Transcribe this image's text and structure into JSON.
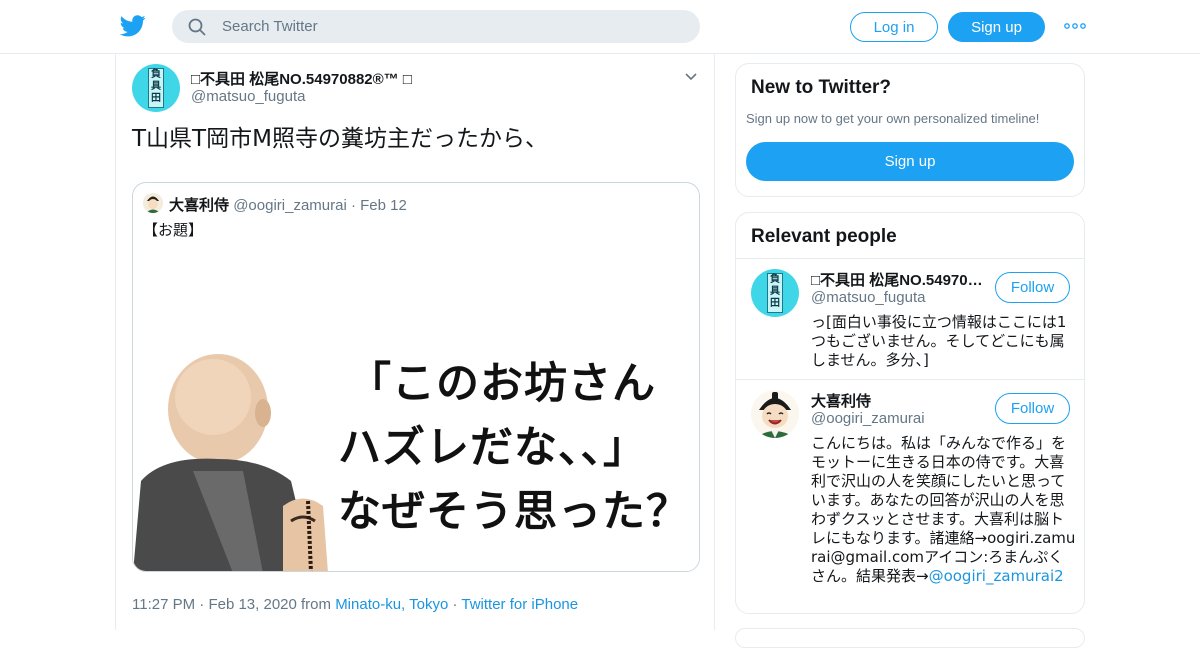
{
  "header": {
    "logo_icon": "twitter-bird-icon",
    "search_placeholder": "Search Twitter",
    "login_label": "Log in",
    "signup_label": "Sign up",
    "more_icon": "more-dots-icon",
    "brand_color": "#1da1f2"
  },
  "tweet": {
    "author_name": "□不具田 松尾NO.54970882®™ □",
    "author_handle": "@matsuo_fuguta",
    "avatar_text": "負具田",
    "text": "T山県T岡市M照寺の糞坊主だったから、",
    "quoted": {
      "name": "大喜利侍",
      "handle": "@oogiri_zamurai",
      "separator": "·",
      "date": "Feb 12",
      "text": "【お題】",
      "image_lines": [
        "「このお坊さん",
        "ハズレだな、、」",
        "なぜそう思った？"
      ]
    },
    "time": "11:27 PM",
    "sep": "·",
    "date": "Feb 13, 2020",
    "from_label": "from",
    "location": "Minato-ku, Tokyo",
    "source": "Twitter for iPhone"
  },
  "sidebar": {
    "new_title": "New to Twitter?",
    "new_subtitle": "Sign up now to get your own personalized timeline!",
    "signup_label": "Sign up",
    "relevant_title": "Relevant people",
    "people": [
      {
        "name": "□不具田 松尾NO.54970…",
        "handle": "@matsuo_fuguta",
        "follow_label": "Follow",
        "bio": "っ[面白い事役に立つ情報はここには1つもございません。そしてどこにも属しません。多分、]"
      },
      {
        "name": "大喜利侍",
        "handle": "@oogiri_zamurai",
        "follow_label": "Follow",
        "bio": "こんにちは。私は「みんなで作る」をモットーに生きる日本の侍です。大喜利で沢山の人を笑顔にしたいと思っています。あなたの回答が沢山の人を思わずクスッとさせます。大喜利は脳トレにもなります。諸連絡→oogiri.zamurai@gmail.comアイコン:ろまんぷくさん。結果発表→",
        "bio_link": "@oogiri_zamurai2"
      }
    ]
  }
}
